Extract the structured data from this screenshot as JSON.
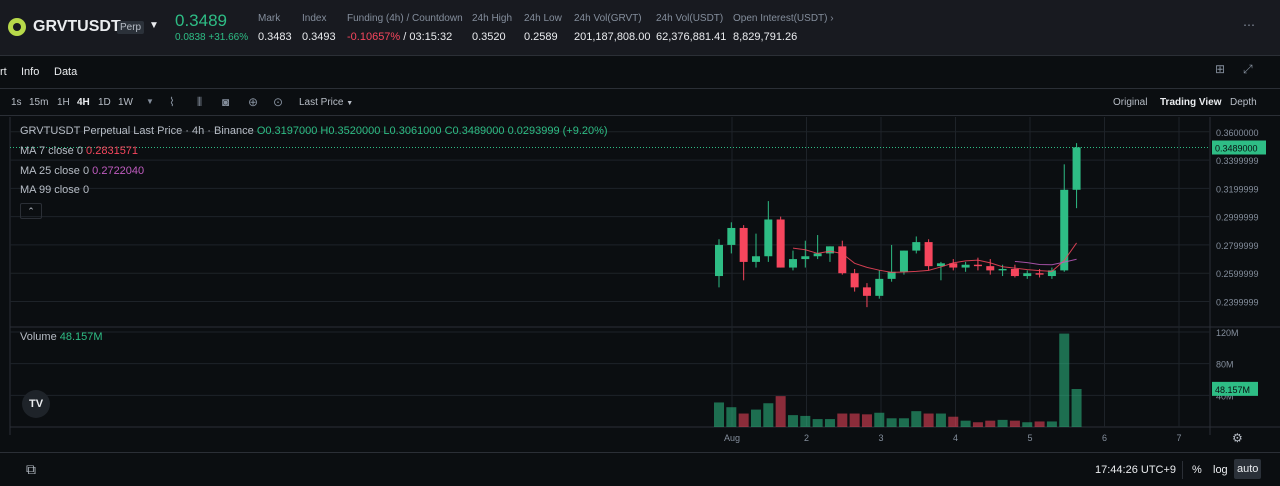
{
  "ticker": {
    "symbol": "GRVTUSDT",
    "badge": "Perp",
    "last_price": "0.3489",
    "change": "0.0838 +31.66%",
    "stats": [
      {
        "label": "Mark",
        "value": "0.3483"
      },
      {
        "label": "Index",
        "value": "0.3493"
      },
      {
        "label": "Funding (4h) / Countdown",
        "value_neg": "-0.10657%",
        "value": " / 03:15:32"
      },
      {
        "label": "24h High",
        "value": "0.3520"
      },
      {
        "label": "24h Low",
        "value": "0.2589"
      },
      {
        "label": "24h Vol(GRVT)",
        "value": "201,187,808.00"
      },
      {
        "label": "24h Vol(USDT)",
        "value": "62,376,881.41"
      },
      {
        "label": "Open Interest(USDT)",
        "value": "8,829,791.26"
      }
    ]
  },
  "tabs": [
    "rt",
    "Info",
    "Data"
  ],
  "toolbar": {
    "intervals": [
      "1s",
      "15m",
      "1H",
      "4H",
      "1D",
      "1W"
    ],
    "active_interval": "4H",
    "price_type": "Last Price",
    "views": [
      "Original",
      "Trading View",
      "Depth"
    ],
    "active_view": "Trading View"
  },
  "legend": {
    "title": "GRVTUSDT Perpetual Last Price · 4h · Binance",
    "ohlc": "O0.3197000 H0.3520000 L0.3061000 C0.3489000 0.0293999 (+9.20%)",
    "ma7_label": "MA 7 close 0",
    "ma7_value": "0.2831571",
    "ma25_label": "MA 25 close 0",
    "ma25_value": "0.2722040",
    "ma99_label": "MA 99 close 0",
    "volume_label": "Volume",
    "volume_value": "48.157M"
  },
  "colors": {
    "up": "#2ebd85",
    "down": "#f6465d",
    "ma7": "#f6465d",
    "ma25": "#c05cc0",
    "accent": "#2ebd85"
  },
  "chart_data": {
    "type": "candlestick",
    "price_axis": {
      "ticks": [
        "0.3600000",
        "0.3399999",
        "0.3199999",
        "0.2999999",
        "0.2799999",
        "0.2599999",
        "0.2399999"
      ],
      "range": [
        0.2255,
        0.3634
      ],
      "current_label": "0.3489000"
    },
    "x_ticks": [
      "Aug",
      "2",
      "3",
      "4",
      "5",
      "6",
      "7"
    ],
    "candles": [
      {
        "o": 0.258,
        "h": 0.284,
        "l": 0.25,
        "c": 0.28
      },
      {
        "o": 0.28,
        "h": 0.296,
        "l": 0.274,
        "c": 0.292
      },
      {
        "o": 0.292,
        "h": 0.294,
        "l": 0.255,
        "c": 0.268
      },
      {
        "o": 0.268,
        "h": 0.288,
        "l": 0.264,
        "c": 0.272
      },
      {
        "o": 0.272,
        "h": 0.311,
        "l": 0.268,
        "c": 0.298
      },
      {
        "o": 0.298,
        "h": 0.3,
        "l": 0.264,
        "c": 0.264
      },
      {
        "o": 0.264,
        "h": 0.276,
        "l": 0.262,
        "c": 0.27
      },
      {
        "o": 0.27,
        "h": 0.283,
        "l": 0.264,
        "c": 0.272
      },
      {
        "o": 0.272,
        "h": 0.287,
        "l": 0.27,
        "c": 0.274
      },
      {
        "o": 0.274,
        "h": 0.279,
        "l": 0.268,
        "c": 0.279
      },
      {
        "o": 0.279,
        "h": 0.283,
        "l": 0.259,
        "c": 0.26
      },
      {
        "o": 0.26,
        "h": 0.263,
        "l": 0.247,
        "c": 0.25
      },
      {
        "o": 0.25,
        "h": 0.253,
        "l": 0.236,
        "c": 0.244
      },
      {
        "o": 0.244,
        "h": 0.262,
        "l": 0.242,
        "c": 0.256
      },
      {
        "o": 0.256,
        "h": 0.28,
        "l": 0.254,
        "c": 0.261
      },
      {
        "o": 0.261,
        "h": 0.276,
        "l": 0.259,
        "c": 0.276
      },
      {
        "o": 0.276,
        "h": 0.286,
        "l": 0.274,
        "c": 0.282
      },
      {
        "o": 0.282,
        "h": 0.284,
        "l": 0.262,
        "c": 0.265
      },
      {
        "o": 0.265,
        "h": 0.268,
        "l": 0.255,
        "c": 0.267
      },
      {
        "o": 0.267,
        "h": 0.27,
        "l": 0.262,
        "c": 0.264
      },
      {
        "o": 0.264,
        "h": 0.268,
        "l": 0.261,
        "c": 0.266
      },
      {
        "o": 0.266,
        "h": 0.271,
        "l": 0.262,
        "c": 0.265
      },
      {
        "o": 0.265,
        "h": 0.27,
        "l": 0.259,
        "c": 0.262
      },
      {
        "o": 0.262,
        "h": 0.266,
        "l": 0.258,
        "c": 0.263
      },
      {
        "o": 0.263,
        "h": 0.266,
        "l": 0.257,
        "c": 0.258
      },
      {
        "o": 0.258,
        "h": 0.262,
        "l": 0.256,
        "c": 0.26
      },
      {
        "o": 0.26,
        "h": 0.263,
        "l": 0.257,
        "c": 0.259
      },
      {
        "o": 0.258,
        "h": 0.264,
        "l": 0.256,
        "c": 0.262
      },
      {
        "o": 0.262,
        "h": 0.337,
        "l": 0.261,
        "c": 0.319
      },
      {
        "o": 0.319,
        "h": 0.352,
        "l": 0.306,
        "c": 0.349
      }
    ],
    "volume_axis": {
      "ticks": [
        "120M",
        "80M",
        "40M"
      ],
      "range": [
        0,
        120
      ],
      "current_label": "48.157M"
    },
    "volumes": [
      31,
      25,
      17,
      22,
      30,
      39,
      15,
      14,
      10,
      10,
      17,
      17,
      16,
      18,
      11,
      11,
      20,
      17,
      17,
      13,
      8,
      6,
      8,
      9,
      8,
      6,
      7,
      7,
      118,
      48
    ]
  },
  "bottom": {
    "time": "17:44:26 UTC+9",
    "percent": "%",
    "log": "log",
    "auto": "auto"
  }
}
